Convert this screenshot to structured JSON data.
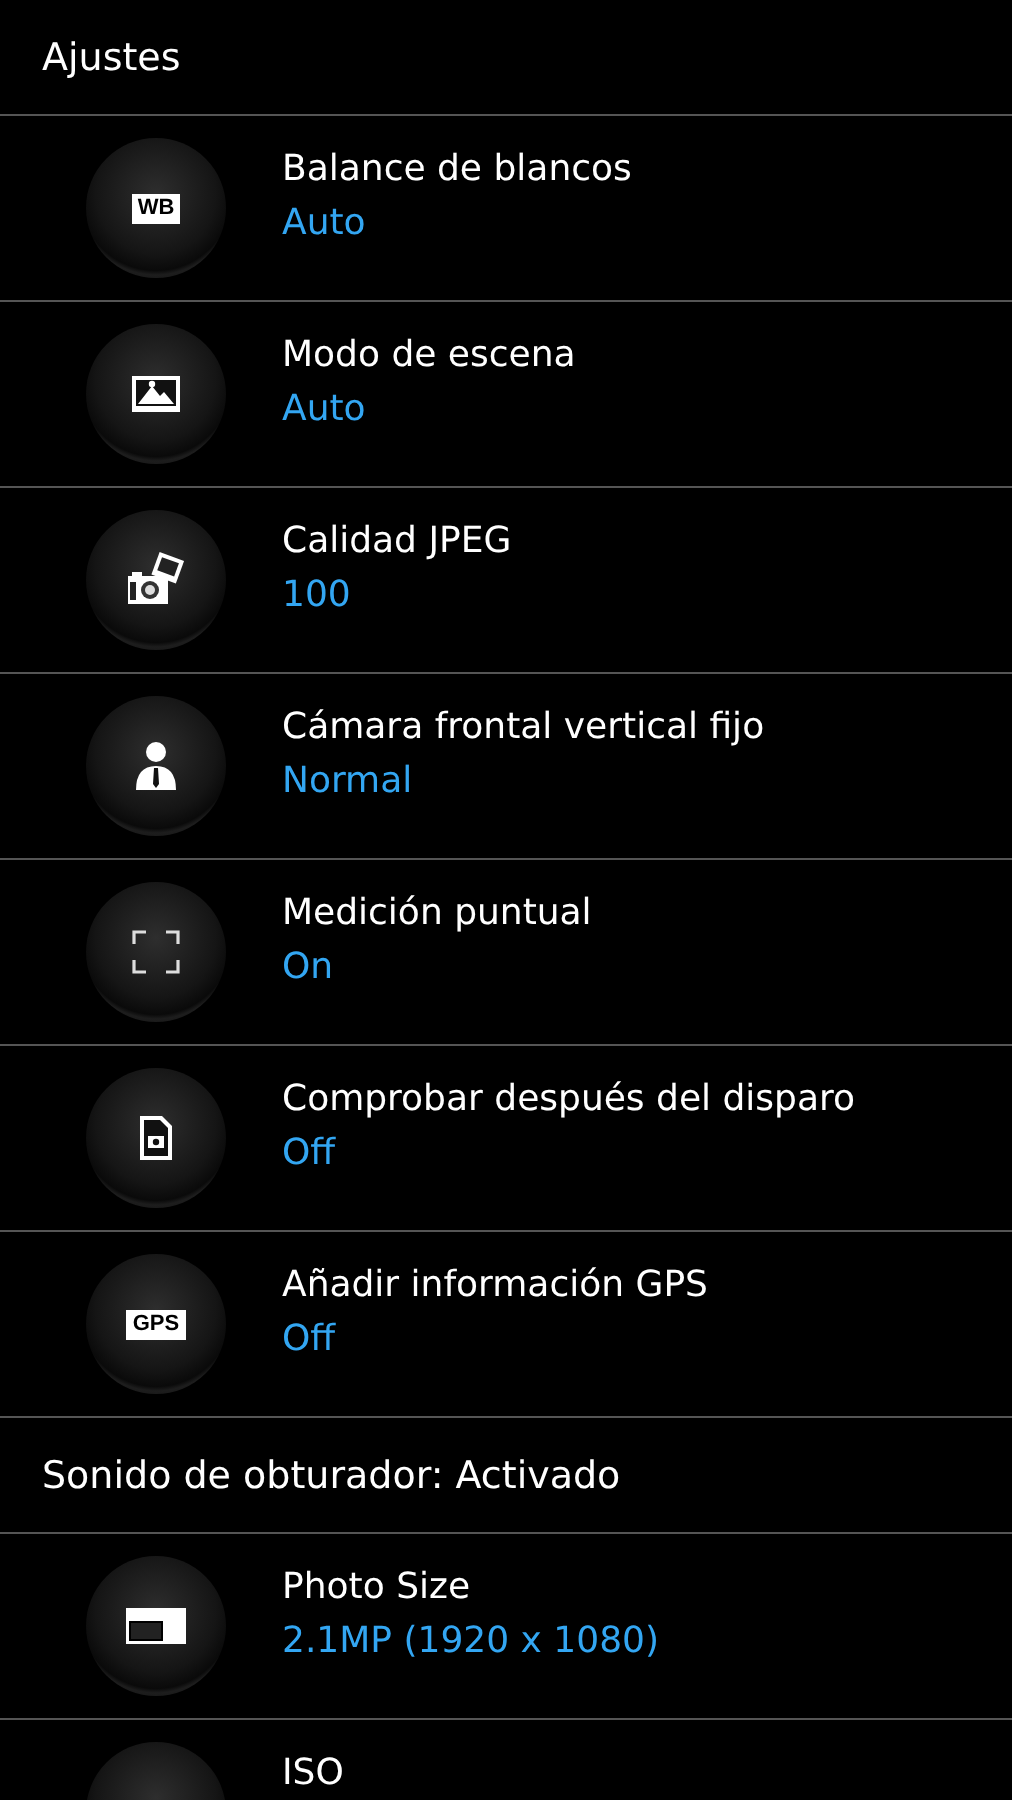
{
  "items": [
    {
      "kind": "header",
      "title": "Ajustes"
    },
    {
      "kind": "setting",
      "badge": "WB",
      "title": "Balance de blancos",
      "value": "Auto"
    },
    {
      "kind": "setting",
      "title": "Modo de escena",
      "value": "Auto"
    },
    {
      "kind": "setting",
      "title": "Calidad JPEG",
      "value": "100"
    },
    {
      "kind": "setting",
      "title": "Cámara frontal vertical fijo",
      "value": "Normal"
    },
    {
      "kind": "setting",
      "title": "Medición puntual",
      "value": "On"
    },
    {
      "kind": "setting",
      "title": "Comprobar después del disparo",
      "value": "Off"
    },
    {
      "kind": "setting",
      "badge": "GPS",
      "title": "Añadir información GPS",
      "value": "Off"
    },
    {
      "kind": "header",
      "title": "Sonido de obturador: Activado"
    },
    {
      "kind": "setting",
      "title": "Photo Size",
      "value": "2.1MP (1920 x 1080)"
    },
    {
      "kind": "setting",
      "title": "ISO"
    }
  ]
}
